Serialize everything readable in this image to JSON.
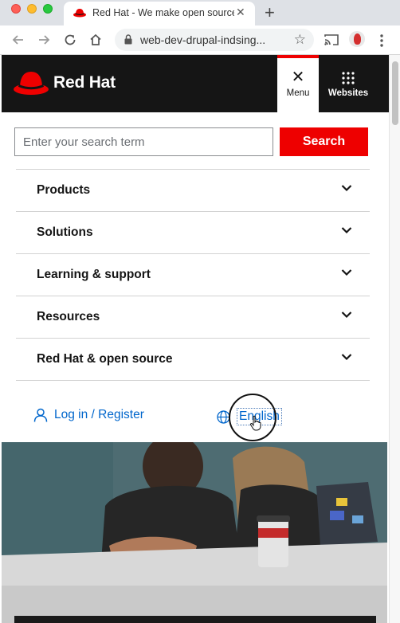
{
  "browser": {
    "tab_title": "Red Hat - We make open source technologies for the enterprise",
    "url": "web-dev-drupal-indsing...",
    "icons": [
      "back-icon",
      "forward-icon",
      "reload-icon",
      "home-icon",
      "lock-icon",
      "star-icon",
      "cast-icon",
      "profile-avatar",
      "kebab-menu-icon"
    ]
  },
  "header": {
    "brand": "Red Hat",
    "menu_label": "Menu",
    "websites_label": "Websites"
  },
  "search": {
    "placeholder": "Enter your search term",
    "button_label": "Search"
  },
  "nav": {
    "items": [
      {
        "label": "Products"
      },
      {
        "label": "Solutions"
      },
      {
        "label": "Learning & support"
      },
      {
        "label": "Resources"
      },
      {
        "label": "Red Hat & open source"
      }
    ]
  },
  "account": {
    "login_label": "Log in / Register",
    "language_label": "English"
  },
  "colors": {
    "brand_red": "#ee0000",
    "header_bg": "#151515",
    "link_blue": "#0066cc"
  }
}
